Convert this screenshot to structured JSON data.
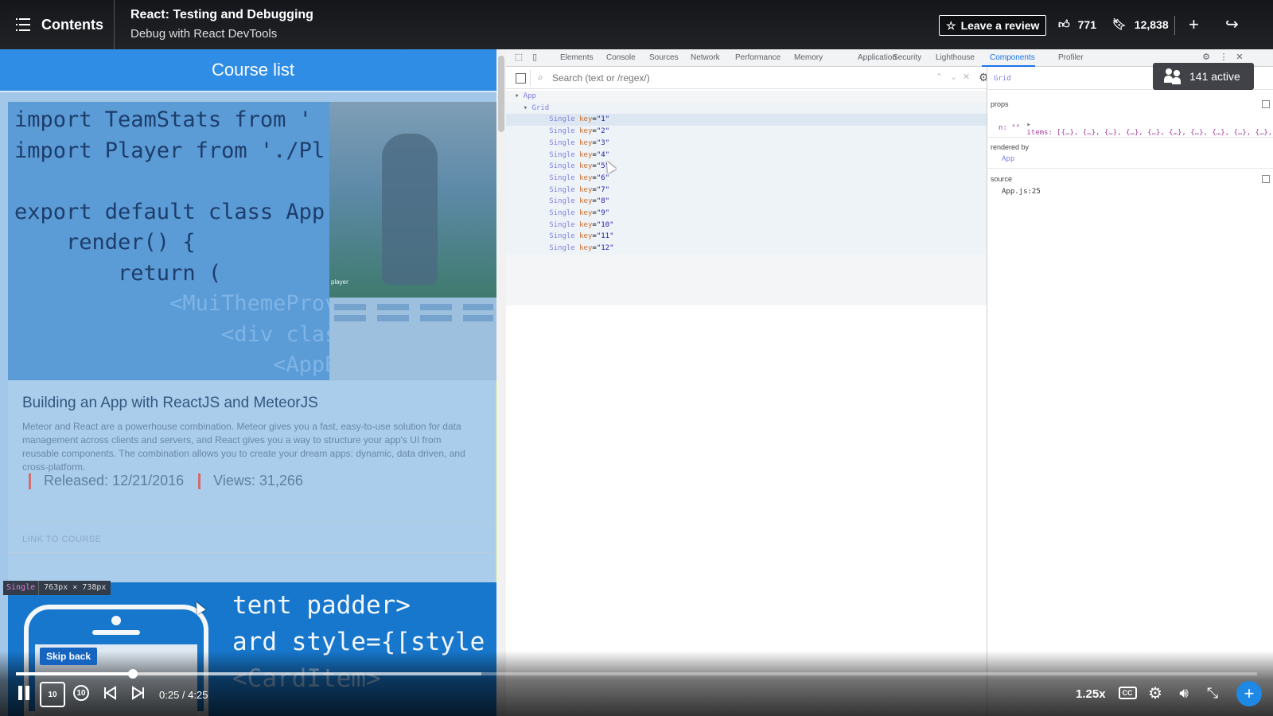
{
  "player": {
    "contents_label": "Contents",
    "course_title": "React: Testing and Debugging",
    "clip_title": "Debug with React DevTools",
    "review_label": "Leave a review",
    "likes": "771",
    "bookmarks": "12,838",
    "active_viewers": "141 active",
    "skip_back_tooltip": "Skip back",
    "skip_back_seconds": "10",
    "skip_forward_seconds": "10",
    "time_display": "0:25 / 4:25",
    "progress_fraction": 0.0943,
    "buffered_fraction": 0.375,
    "speed": "1.25x",
    "cc_label": "CC"
  },
  "app_page": {
    "header": "Course list",
    "code_lines": [
      "import TeamStats from '",
      "import Player from './Pl",
      "",
      "export default class App",
      "    render() {",
      "        return (",
      "            <MuiThemeProvide",
      "                <div classNa",
      "                    <AppBar"
    ],
    "photo_caption": "player",
    "card_title": "Building an App with ReactJS and MeteorJS",
    "card_description": "Meteor and React are a powerhouse combination. Meteor gives you a fast, easy-to-use solution for data management across clients and servers, and React gives you a way to structure your app's UI from reusable components. The combination allows you to create your dream apps: dynamic, data driven, and cross-platform.",
    "released": "Released: 12/21/2016",
    "views": "Views: 31,266",
    "link_label": "LINK TO COURSE",
    "tooltip_component": "Single",
    "tooltip_size": "763px × 738px",
    "second_card_code": [
      "tent padder>",
      "ard style={[style",
      "<CardItem>"
    ]
  },
  "devtools": {
    "tabs": [
      "Elements",
      "Console",
      "Sources",
      "Network",
      "Performance",
      "Memory",
      "Application",
      "Security",
      "Lighthouse",
      "Components",
      "Profiler"
    ],
    "active_tab": "Components",
    "search_placeholder": "Search (text or /regex/)",
    "tree": {
      "root": "App",
      "child": "Grid",
      "item_component": "Single",
      "item_key_attr": "key",
      "keys": [
        "\"1\"",
        "\"2\"",
        "\"3\"",
        "\"4\"",
        "\"5\"",
        "\"6\"",
        "\"7\"",
        "\"8\"",
        "\"9\"",
        "\"10\"",
        "\"11\"",
        "\"12\""
      ]
    },
    "inspector": {
      "selected": "Grid",
      "props_label": "props",
      "props_items": "items: [{…}, {…}, {…}, {…}, {…}, {…}, {…}, {…}, {…}, {…}, …]",
      "props_n": "n: \"\"",
      "rendered_by_label": "rendered by",
      "rendered_by_value": "App",
      "source_label": "source",
      "source_value": "App.js:25"
    }
  }
}
